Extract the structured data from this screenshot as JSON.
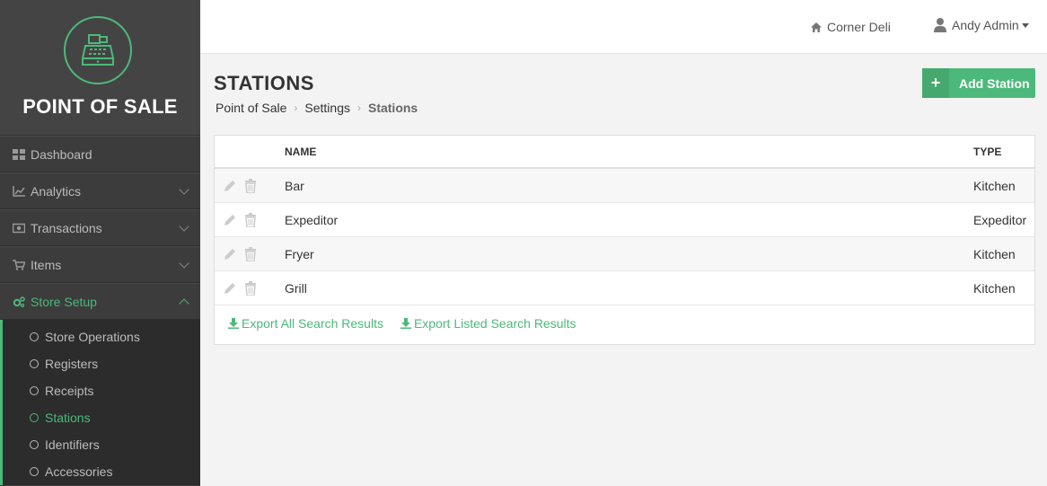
{
  "brand": {
    "title": "POINT OF SALE",
    "accent": "#4cb97a"
  },
  "sidebar": {
    "items": [
      {
        "label": "Dashboard",
        "icon": "grid-icon",
        "expandable": false
      },
      {
        "label": "Analytics",
        "icon": "line-chart-icon",
        "expandable": true
      },
      {
        "label": "Transactions",
        "icon": "money-icon",
        "expandable": true
      },
      {
        "label": "Items",
        "icon": "cart-icon",
        "expandable": true
      },
      {
        "label": "Store Setup",
        "icon": "cogs-icon",
        "expandable": true,
        "active": true
      }
    ],
    "store_setup_subitems": [
      {
        "label": "Store Operations"
      },
      {
        "label": "Registers"
      },
      {
        "label": "Receipts"
      },
      {
        "label": "Stations",
        "active": true
      },
      {
        "label": "Identifiers"
      },
      {
        "label": "Accessories"
      }
    ]
  },
  "topbar": {
    "store_name": "Corner Deli",
    "user_name": "Andy Admin"
  },
  "page": {
    "title": "STATIONS",
    "breadcrumb": [
      "Point of Sale",
      "Settings",
      "Stations"
    ],
    "add_button": "Add Station"
  },
  "table": {
    "columns": [
      "NAME",
      "TYPE"
    ],
    "rows": [
      {
        "name": "Bar",
        "type": "Kitchen"
      },
      {
        "name": "Expeditor",
        "type": "Expeditor"
      },
      {
        "name": "Fryer",
        "type": "Kitchen"
      },
      {
        "name": "Grill",
        "type": "Kitchen"
      }
    ],
    "exports": [
      "Export All Search Results",
      "Export Listed Search Results"
    ]
  }
}
